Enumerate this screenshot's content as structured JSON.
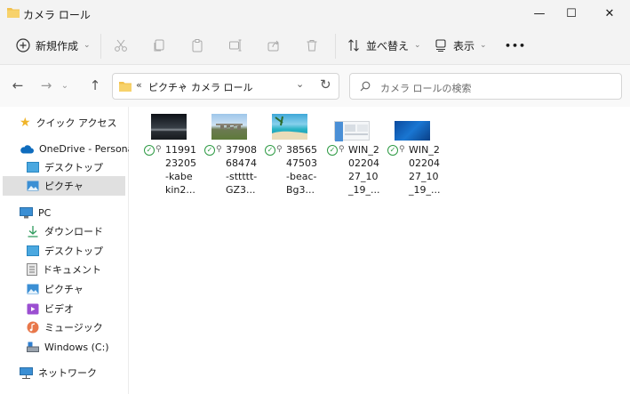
{
  "window": {
    "title": "カメラ ロール",
    "minimize": "—",
    "maximize": "☐",
    "close": "✕"
  },
  "toolbar": {
    "new_label": "新規作成",
    "sort_label": "並べ替え",
    "view_label": "表示",
    "more": "•••"
  },
  "address": {
    "overflow": "«",
    "segments": [
      "ピクチャ",
      "カメラ ロール"
    ],
    "separator": "›"
  },
  "search": {
    "placeholder": "カメラ ロールの検索"
  },
  "sidebar": {
    "items": [
      {
        "label": "クイック アクセス",
        "icon": "star-icon"
      },
      {
        "label": "OneDrive - Personal",
        "icon": "cloud-icon"
      },
      {
        "label": "デスクトップ",
        "icon": "desktop-icon"
      },
      {
        "label": "ピクチャ",
        "icon": "pictures-icon",
        "selected": true
      },
      {
        "label": "PC",
        "icon": "pc-icon"
      },
      {
        "label": "ダウンロード",
        "icon": "download-icon"
      },
      {
        "label": "デスクトップ",
        "icon": "desktop-icon"
      },
      {
        "label": "ドキュメント",
        "icon": "document-icon"
      },
      {
        "label": "ピクチャ",
        "icon": "pictures-icon"
      },
      {
        "label": "ビデオ",
        "icon": "video-icon"
      },
      {
        "label": "ミュージック",
        "icon": "music-icon"
      },
      {
        "label": "Windows (C:)",
        "icon": "drive-icon"
      },
      {
        "label": "ネットワーク",
        "icon": "network-icon"
      }
    ]
  },
  "files": [
    {
      "name": "11991\n23205\n-kabe\nkin2...",
      "thumb": "night-sky-thumbnail"
    },
    {
      "name": "37908\n68474\n-sttttt-\nGZ3...",
      "thumb": "stonehenge-thumbnail"
    },
    {
      "name": "38565\n47503\n-beac-\nBg3...",
      "thumb": "beach-thumbnail"
    },
    {
      "name": "WIN_2\n02204\n27_10\n_19_...",
      "thumb": "screenshot-thumbnail"
    },
    {
      "name": "WIN_2\n02204\n27_10\n_19_...",
      "thumb": "desktop-thumbnail"
    }
  ],
  "colors": {
    "accent": "#0067c0",
    "folder": "#f2c14e",
    "sync_ok": "#2e9a44"
  }
}
